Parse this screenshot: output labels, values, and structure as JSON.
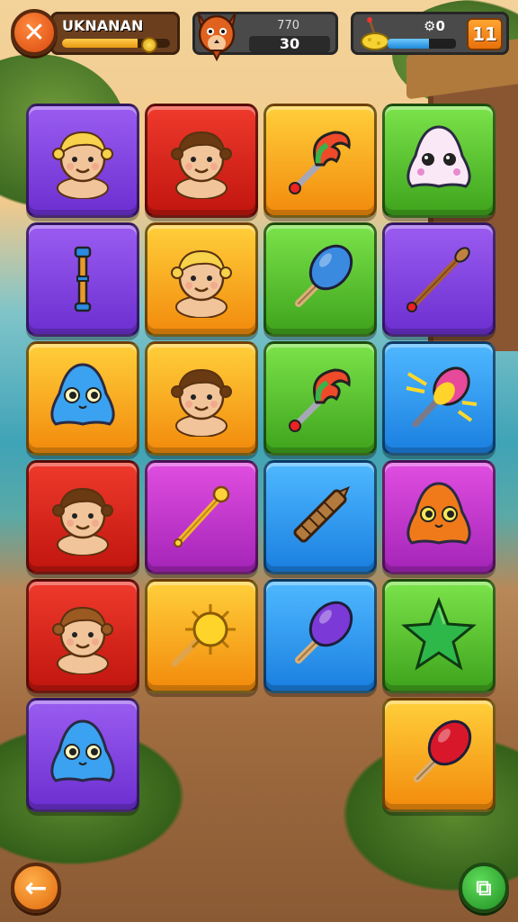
{
  "player": {
    "name": "UKNANAN",
    "xp_fraction": 0.7
  },
  "score": {
    "small": "770",
    "big": "30"
  },
  "resource": {
    "count": "0",
    "fill_fraction": 0.6,
    "level": "11"
  },
  "colors": {
    "purple": "#7c3ae0",
    "red": "#d0201a",
    "orange": "#f5a41c",
    "green": "#54c22c",
    "blue": "#2a94ee",
    "magenta": "#c236cc"
  },
  "tiles": [
    {
      "color": "purple",
      "icon": "blonde-baby-icon"
    },
    {
      "color": "red",
      "icon": "brown-hair-boy-icon"
    },
    {
      "color": "orange",
      "icon": "claw-scepter-icon"
    },
    {
      "color": "green",
      "icon": "white-blob-creature-icon"
    },
    {
      "color": "purple",
      "icon": "blue-staff-icon"
    },
    {
      "color": "orange",
      "icon": "blonde-baby-icon"
    },
    {
      "color": "green",
      "icon": "blue-maraca-icon"
    },
    {
      "color": "purple",
      "icon": "wooden-wand-icon"
    },
    {
      "color": "orange",
      "icon": "blue-blob-creature-icon"
    },
    {
      "color": "orange",
      "icon": "brown-hair-boy-icon"
    },
    {
      "color": "green",
      "icon": "claw-scepter-icon"
    },
    {
      "color": "blue",
      "icon": "flaming-torch-icon"
    },
    {
      "color": "red",
      "icon": "brown-hair-boy-icon"
    },
    {
      "color": "magenta",
      "icon": "golden-scepter-icon"
    },
    {
      "color": "blue",
      "icon": "wooden-club-icon"
    },
    {
      "color": "magenta",
      "icon": "orange-blob-creature-icon"
    },
    {
      "color": "red",
      "icon": "brown-hair-baby-icon"
    },
    {
      "color": "orange",
      "icon": "sun-wand-icon"
    },
    {
      "color": "blue",
      "icon": "purple-maraca-icon"
    },
    {
      "color": "green",
      "icon": "green-star-icon"
    },
    {
      "color": "purple",
      "icon": "blue-blob-creature-icon"
    },
    null,
    null,
    {
      "color": "orange",
      "icon": "red-maraca-icon"
    }
  ],
  "nav": {
    "back_icon": "back-arrow-icon",
    "menu_icon": "menu-icon"
  }
}
